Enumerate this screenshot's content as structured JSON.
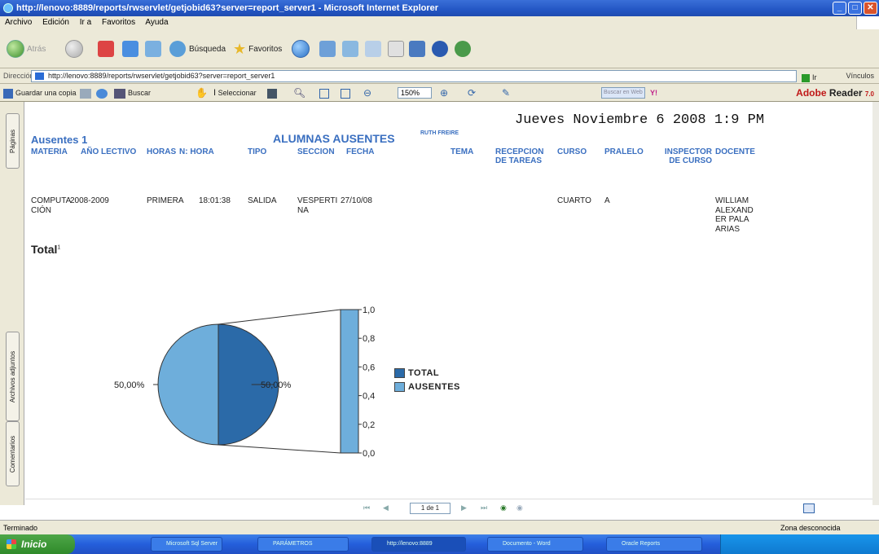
{
  "window": {
    "title": "http://lenovo:8889/reports/rwservlet/getjobid63?server=report_server1 - Microsoft Internet Explorer"
  },
  "menu": [
    "Archivo",
    "Edición",
    "Ir a",
    "Favoritos",
    "Ayuda"
  ],
  "toolbar": {
    "back": "Atrás",
    "search": "Búsqueda",
    "favorites": "Favoritos"
  },
  "address": {
    "label": "Dirección",
    "url": "http://lenovo:8889/reports/rwservlet/getjobid63?server=report_server1",
    "go": "Ir",
    "links": "Vínculos"
  },
  "pdf": {
    "save": "Guardar una copia",
    "find": "Buscar",
    "select": "Seleccionar",
    "zoom": "150%",
    "search_placeholder": "Buscar en Web",
    "brand_a": "Adobe",
    "brand_b": "Reader",
    "brand_v": "7.0"
  },
  "side_tabs": {
    "pages": "Páginas",
    "attachments": "Archivos adjuntos",
    "comments": "Comentarios"
  },
  "report": {
    "datetime": "Jueves Noviembre 6 2008 1:9 PM",
    "ausentes_label": "Ausentes 1",
    "title": "ALUMNAS AUSENTES",
    "user": "RUTH FREIRE",
    "headers": {
      "materia": "MATERIA",
      "anio": "AÑO LECTIVO",
      "horas": "HORAS",
      "nhora": "N: HORA",
      "tipo": "TIPO",
      "seccion": "SECCION",
      "fecha": "FECHA",
      "tema": "TEMA",
      "recepcion": "RECEPCION DE TAREAS",
      "curso": "CURSO",
      "paralelo": "PRALELO",
      "inspector": "INSPECTOR DE CURSO",
      "docente": "DOCENTE"
    },
    "row": {
      "materia": "COMPUTA CIÓN",
      "anio": "2008-2009",
      "horas": "PRIMERA",
      "nhora": "18:01:38",
      "tipo": "SALIDA",
      "seccion": "VESPERTI NA",
      "fecha": "27/10/08",
      "curso": "CUARTO",
      "paralelo": "A",
      "docente": "WILLIAM ALEXAND ER PALA ARIAS"
    },
    "total_label": "Total",
    "total_sup": "1"
  },
  "chart_data": {
    "type": "pie",
    "slices": [
      {
        "name": "TOTAL",
        "value": 50,
        "label": "50,00%",
        "color": "#2b6aa8"
      },
      {
        "name": "AUSENTES",
        "value": 50,
        "label": "50,00%",
        "color": "#6eaedb"
      }
    ],
    "bar_axis": {
      "ticks": [
        "1,0",
        "0,8",
        "0,6",
        "0,4",
        "0,2",
        "0,0"
      ],
      "range": [
        0,
        1
      ]
    },
    "legend": [
      "TOTAL",
      "AUSENTES"
    ]
  },
  "nav": {
    "page": "1 de 1"
  },
  "status": {
    "left": "Terminado",
    "right": "Zona desconocida"
  },
  "taskbar": {
    "start": "Inicio",
    "items": [
      "Microsoft Sql Server",
      "PARÁMETROS",
      "http://lenovo:8889",
      "Documento - Word",
      "Oracle Reports"
    ]
  }
}
